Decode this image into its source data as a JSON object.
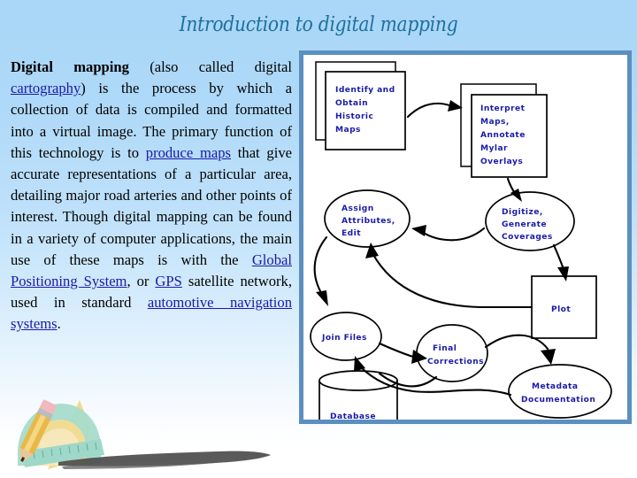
{
  "slide": {
    "title": "Introduction to digital mapping",
    "background_top_color": "#a9d6f7",
    "background_bottom_color": "#ffffff"
  },
  "body": {
    "seg_1_bold": "Digital mapping",
    "seg_2": " (also called digital ",
    "link_cartography": "cartography",
    "seg_3": ") is the process by which a collection of data is compiled and formatted into a virtual image. The primary function of this technology is to ",
    "link_produce_maps": "produce maps",
    "seg_4": " that give accurate representations of a particular area, detailing major road arteries and other points of interest. Though digital mapping can be found in a variety of computer applications, the main use of these maps is with the ",
    "link_gps_full": "Global Positioning System",
    "seg_5": ", or ",
    "link_gps": "GPS",
    "seg_6": " satellite network, used in standard ",
    "link_automotive": "automotive navigation systems",
    "seg_7": ".",
    "link_color": "#1a1aa8",
    "text_color": "#000000"
  },
  "diagram": {
    "frame_border_color": "#5b8fc0",
    "node_text_color": "#1a1aa8",
    "nodes": {
      "identify_obtain": "Identify and\nObtain\nHistoric\nMaps",
      "identify_obtain_lines": [
        "Identify and",
        "Obtain",
        "Historic",
        "Maps"
      ],
      "interpret_maps_lines": [
        "Interpret",
        "Maps,",
        "Annotate",
        "Mylar",
        "Overlays"
      ],
      "assign_attributes_lines": [
        "Assign",
        "Attributes,",
        "Edit"
      ],
      "digitize_lines": [
        "Digitize,",
        "Generate",
        "Coverages"
      ],
      "plot_lines": [
        "Plot"
      ],
      "join_files_lines": [
        "Join Files"
      ],
      "final_corrections_lines": [
        "Final",
        "Corrections"
      ],
      "metadata_lines": [
        "Metadata",
        "Documentation"
      ],
      "database_lines": [
        "Database"
      ]
    },
    "flow_order": [
      "Identify and Obtain Historic Maps",
      "Interpret Maps, Annotate Mylar Overlays",
      "Digitize, Generate Coverages",
      "Assign Attributes, Edit",
      "Plot",
      "Join Files",
      "Final Corrections",
      "Metadata Documentation",
      "Database"
    ]
  },
  "clipart": {
    "name": "drafting-tools-pencil-protractor-ruler",
    "pencil_body_color": "#e8b84a",
    "protractor_color": "#9fd8c8",
    "triangle_color": "#f0d58a",
    "smudge_color": "#4a4a4a"
  }
}
